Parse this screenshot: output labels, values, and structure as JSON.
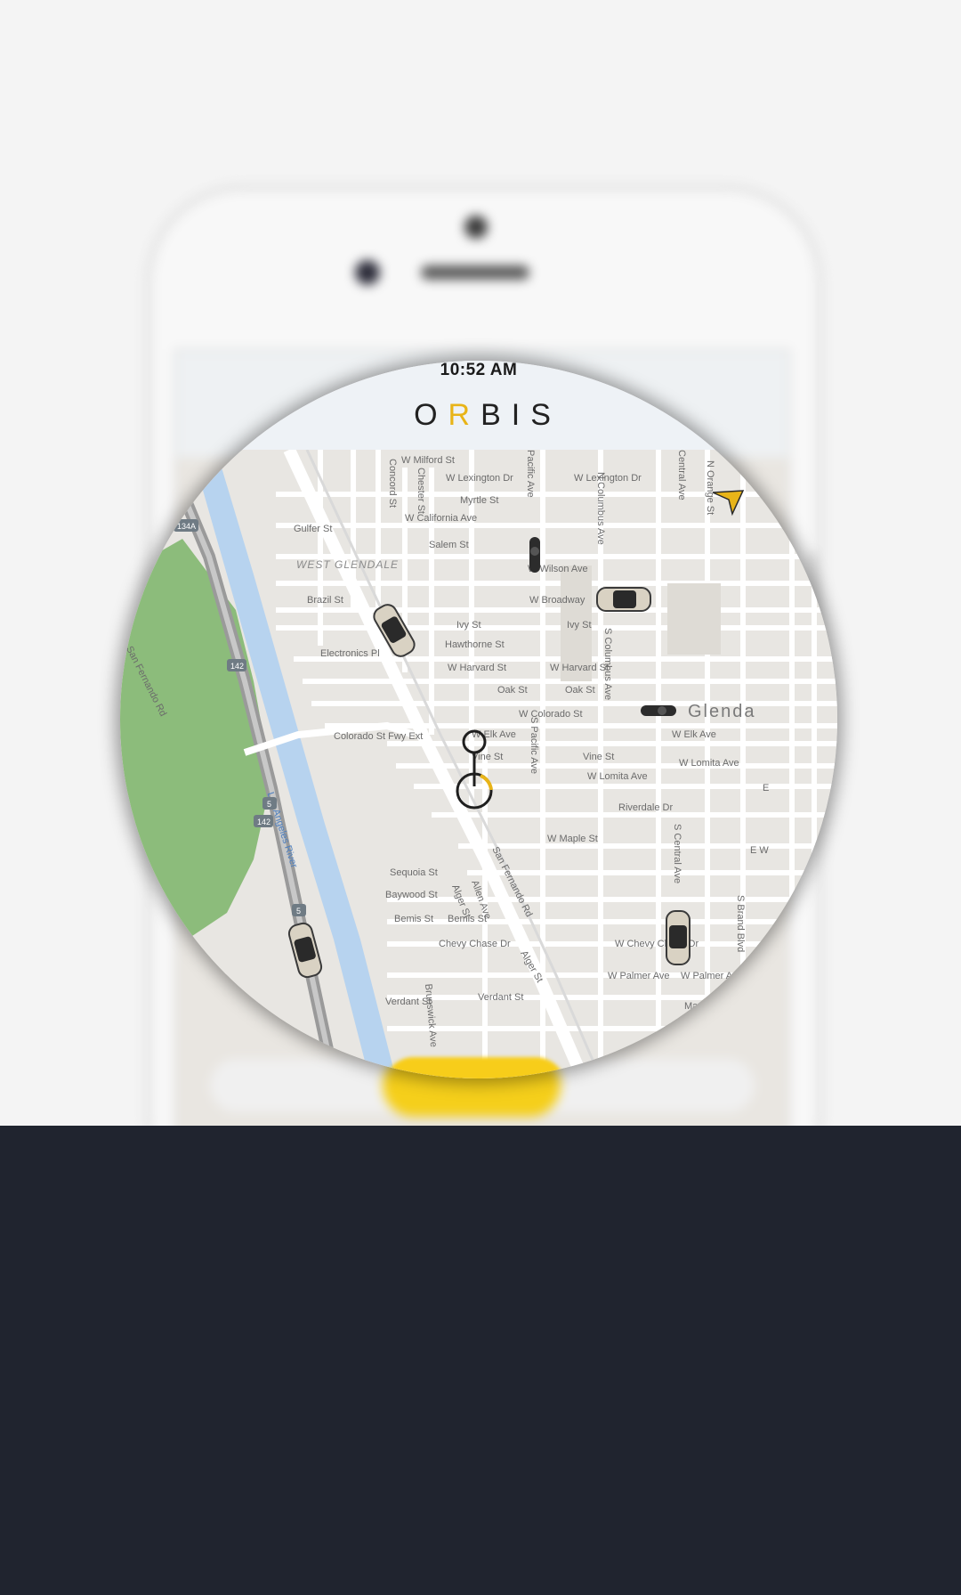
{
  "status_bar": {
    "time": "10:52 AM"
  },
  "app": {
    "logo_prefix": "O",
    "logo_accent": "R",
    "logo_suffix": "BIS"
  },
  "map": {
    "streets": [
      {
        "label": "W Milford St"
      },
      {
        "label": "W Lexington Dr"
      },
      {
        "label": "W Lexington Dr"
      },
      {
        "label": "Myrtle St"
      },
      {
        "label": "Gulfer St"
      },
      {
        "label": "W California Ave"
      },
      {
        "label": "Salem St"
      },
      {
        "label": "WEST GLENDALE"
      },
      {
        "label": "W Wilson Ave"
      },
      {
        "label": "Brazil St"
      },
      {
        "label": "W Broadway"
      },
      {
        "label": "Ivy St"
      },
      {
        "label": "Ivy St"
      },
      {
        "label": "Hawthorne St"
      },
      {
        "label": "Electronics Pl"
      },
      {
        "label": "W Harvard St"
      },
      {
        "label": "W Harvard St"
      },
      {
        "label": "Oak St"
      },
      {
        "label": "Oak St"
      },
      {
        "label": "W Colorado St"
      },
      {
        "label": "Glenda"
      },
      {
        "label": "Colorado St Fwy Ext"
      },
      {
        "label": "W Elk Ave"
      },
      {
        "label": "W Elk Ave"
      },
      {
        "label": "Vine St"
      },
      {
        "label": "Vine St"
      },
      {
        "label": "W Lomita Ave"
      },
      {
        "label": "W Lomita Ave"
      },
      {
        "label": "Riverdale Dr"
      },
      {
        "label": "W Maple St"
      },
      {
        "label": "Los Angeles River"
      },
      {
        "label": "Sequoia St"
      },
      {
        "label": "Baywood St"
      },
      {
        "label": "Bemis St"
      },
      {
        "label": "Bemis St"
      },
      {
        "label": "Chevy Chase Dr"
      },
      {
        "label": "W Chevy Chase Dr"
      },
      {
        "label": "W Palmer Ave"
      },
      {
        "label": "W Palmer Ave"
      },
      {
        "label": "Verdant St"
      },
      {
        "label": "Verdant St"
      },
      {
        "label": "San Fernando Rd"
      },
      {
        "label": "San Fernando Rd"
      },
      {
        "label": "Allen Ave"
      },
      {
        "label": "Concord St"
      },
      {
        "label": "Chester St"
      },
      {
        "label": "Pacific Ave"
      },
      {
        "label": "S Pacific Ave"
      },
      {
        "label": "N Columbus Ave"
      },
      {
        "label": "S Columbus Ave"
      },
      {
        "label": "Central Ave"
      },
      {
        "label": "S Central Ave"
      },
      {
        "label": "N Orange St"
      },
      {
        "label": "S Brand Blvd"
      },
      {
        "label": "Brunswick Ave"
      },
      {
        "label": "Alger St"
      },
      {
        "label": "Alger St"
      },
      {
        "label": "E"
      },
      {
        "label": "E W"
      },
      {
        "label": "Ma"
      }
    ],
    "highway_shields": [
      "134A",
      "142",
      "142",
      "5",
      "5"
    ],
    "accent_color": "#e8b418",
    "vehicles": [
      {
        "name": "car-1-icon"
      },
      {
        "name": "car-2-icon"
      },
      {
        "name": "car-3-icon"
      },
      {
        "name": "car-4-icon"
      },
      {
        "name": "motorbike-1-icon"
      },
      {
        "name": "motorbike-2-icon"
      }
    ]
  },
  "colors": {
    "bottom_panel": "#20242f",
    "yellow_button": "#f7cd1a",
    "map_land": "#e8e6e2",
    "map_park": "#8cbc7b",
    "map_river": "#b7d3ef"
  }
}
